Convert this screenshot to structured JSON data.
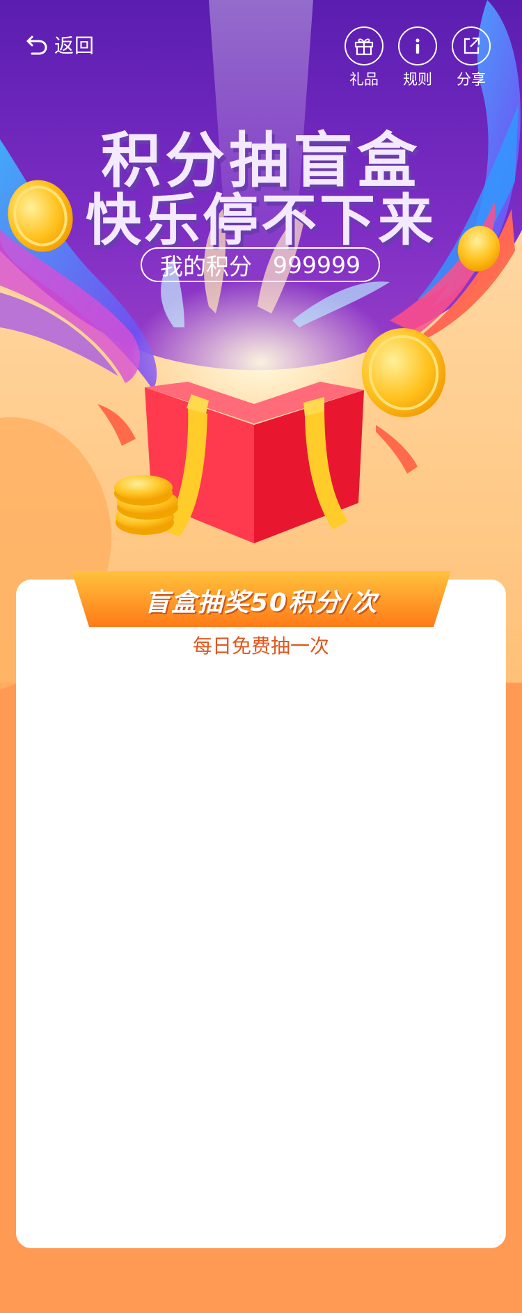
{
  "nav": {
    "back_label": "返回",
    "actions": [
      {
        "label": "礼品",
        "icon": "gift-icon"
      },
      {
        "label": "规则",
        "icon": "info-icon"
      },
      {
        "label": "分享",
        "icon": "share-icon"
      }
    ]
  },
  "hero": {
    "title_line1": "积分抽盲盒",
    "title_line2": "快乐停不下来",
    "points_label": "我的积分",
    "points_value": "999999"
  },
  "draw": {
    "cost_label": "盲盒抽奖50积分/次",
    "free_note": "每日免费抽一次"
  },
  "colors": {
    "purple": "#6a24b8",
    "orange": "#ff9a55",
    "ribbon": "#ff8a22",
    "accent_text": "#e0571e"
  }
}
